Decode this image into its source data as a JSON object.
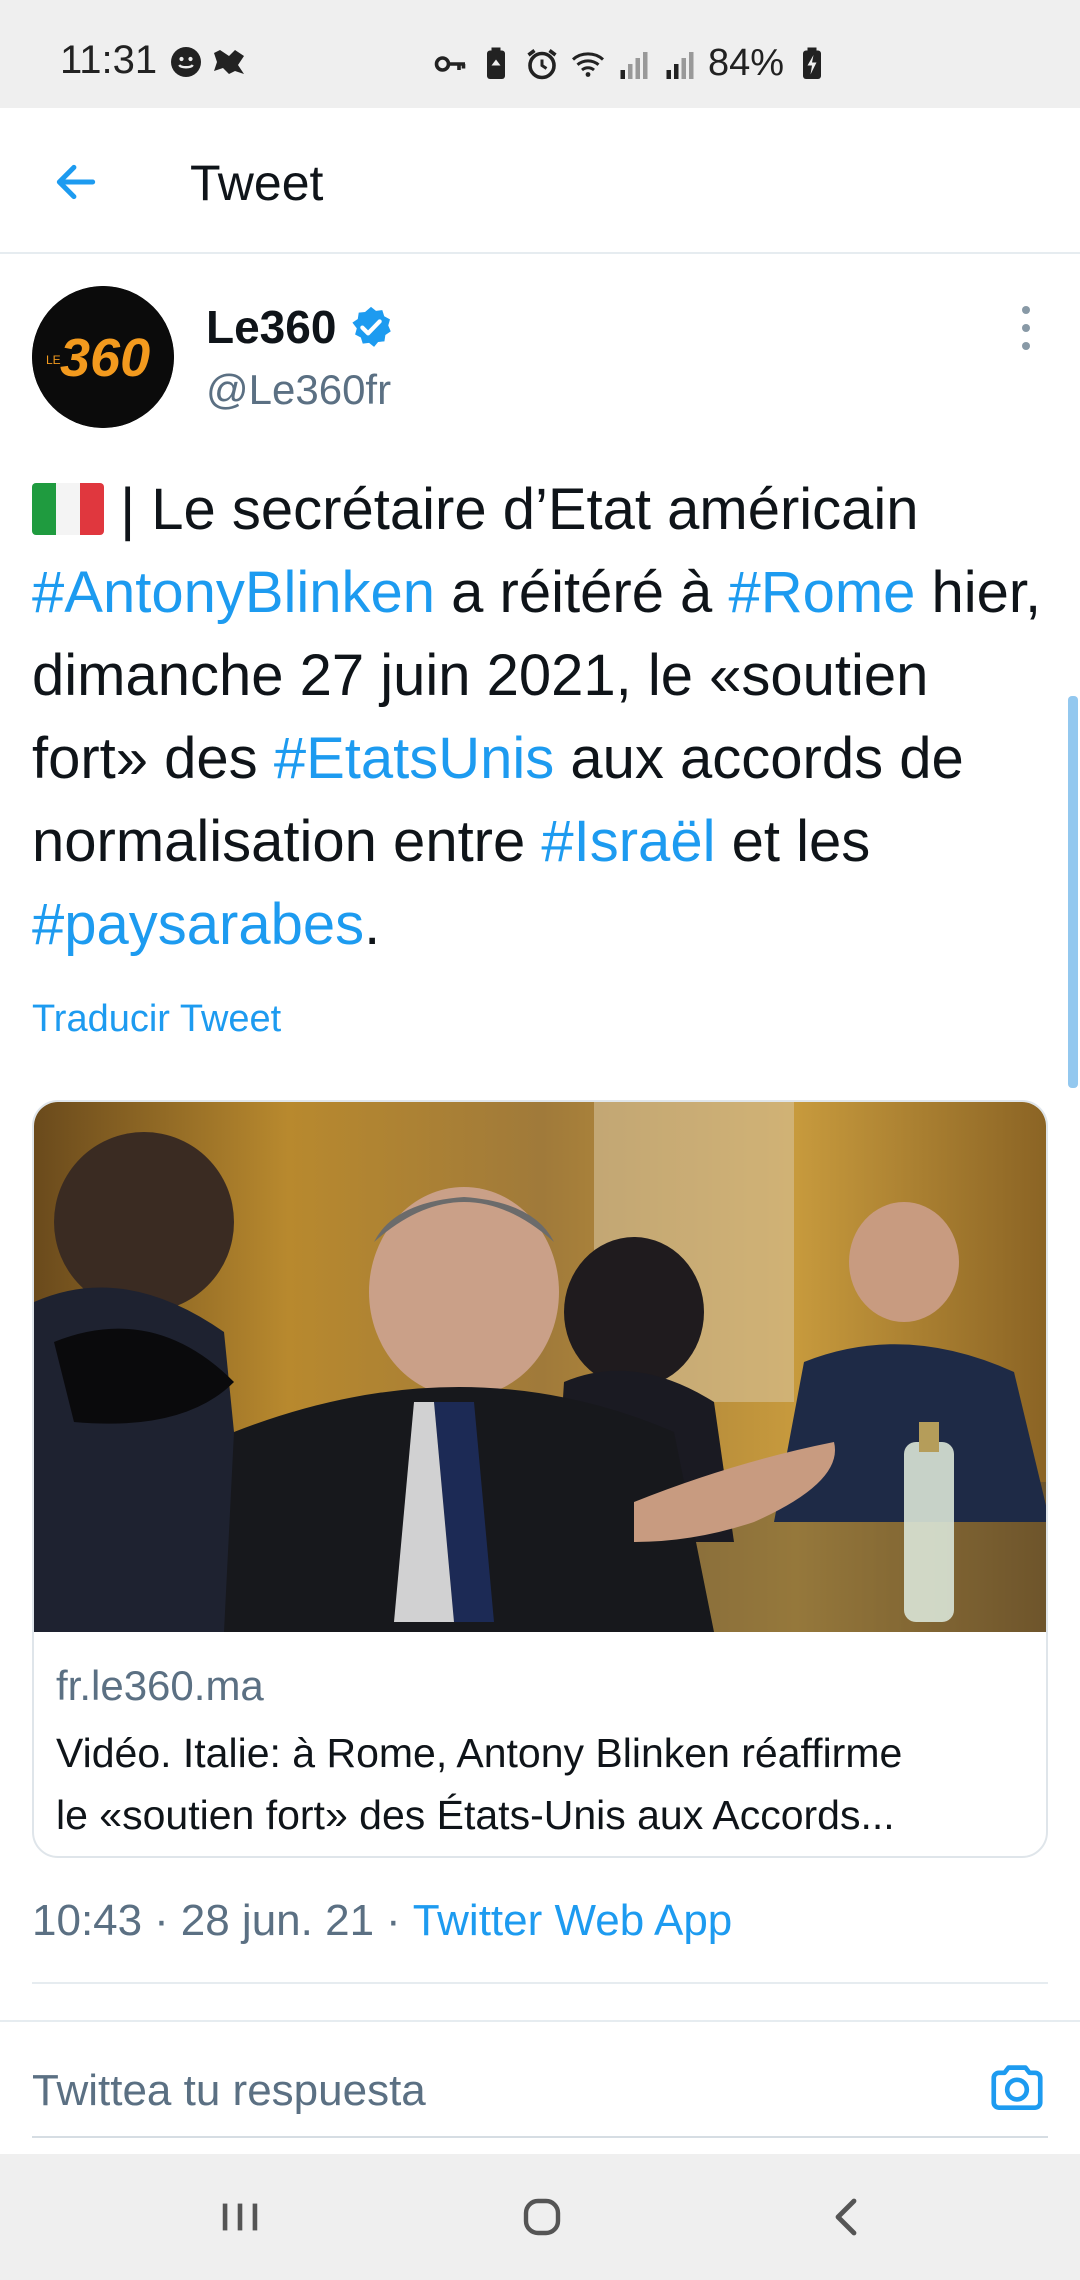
{
  "status_bar": {
    "time": "11:31",
    "battery": "84%"
  },
  "app_bar": {
    "title": "Tweet",
    "back_icon": "arrow-left-icon"
  },
  "tweet": {
    "display_name": "Le360",
    "handle": "@Le360fr",
    "avatar_text": "360",
    "avatar_small_text": "LE",
    "text_parts": {
      "p1": " | Le secrétaire d’Etat américain ",
      "h1": "#AntonyBlinken",
      "p2": " a réitéré à ",
      "h2": "#Rome",
      "p3": " hier, dimanche 27 juin 2021, le «soutien fort» des ",
      "h3": "#EtatsUnis",
      "p4": " aux accords de normalisation entre ",
      "h4": "#Israël",
      "p5": " et les ",
      "h5": "#paysarabes",
      "p6": "."
    },
    "translate_label": "Traducir Tweet",
    "card": {
      "domain": "fr.le360.ma",
      "title_line1": "Vidéo. Italie: à Rome, Antony Blinken réaffirme",
      "title_line2": "le «soutien fort» des États-Unis aux Accords..."
    },
    "meta": {
      "time": "10:43",
      "separator": "·",
      "date": "28 jun. 21",
      "source": "Twitter Web App"
    }
  },
  "reply": {
    "placeholder": "Twittea tu respuesta"
  },
  "colors": {
    "accent": "#1d9bf0",
    "text": "#0f1419",
    "secondary": "#5b7083",
    "avatar_orange": "#f39a1e"
  }
}
